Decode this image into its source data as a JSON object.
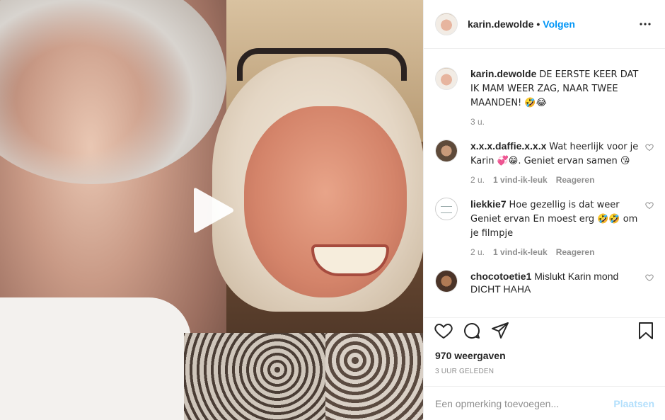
{
  "header": {
    "username": "karin.dewolde",
    "separator": "•",
    "follow_label": "Volgen"
  },
  "caption": {
    "username": "karin.dewolde",
    "text": "DE EERSTE KEER DAT IK MAM WEER ZAG, NAAR TWEE MAANDEN! 🤣😂",
    "time": "3 u."
  },
  "comments": [
    {
      "username": "x.x.x.daffie.x.x.x",
      "text": "Wat heerlijk voor je Karin 💞😁. Geniet ervan samen 😘",
      "time": "2 u.",
      "likes": "1 vind-ik-leuk",
      "reply_label": "Reageren"
    },
    {
      "username": "liekkie7",
      "text": "Hoe gezellig is dat weer Geniet ervan En moest erg 🤣🤣 om je filmpje",
      "time": "2 u.",
      "likes": "1 vind-ik-leuk",
      "reply_label": "Reageren"
    },
    {
      "username": "chocotoetie1",
      "text": "Mislukt Karin mond DICHT HAHA"
    }
  ],
  "views": "970 weergaven",
  "posted_ago": "3 UUR GELEDEN",
  "add_comment": {
    "placeholder": "Een opmerking toevoegen...",
    "post_label": "Plaatsen"
  },
  "colors": {
    "accent": "#0095f6",
    "post_disabled": "#b2dffc",
    "muted": "#8e8e8e",
    "text": "#262626"
  },
  "icons": {
    "play": "play-icon",
    "more": "more-icon",
    "heart": "heart-icon",
    "comment": "comment-icon",
    "share": "share-icon",
    "save": "bookmark-icon"
  }
}
